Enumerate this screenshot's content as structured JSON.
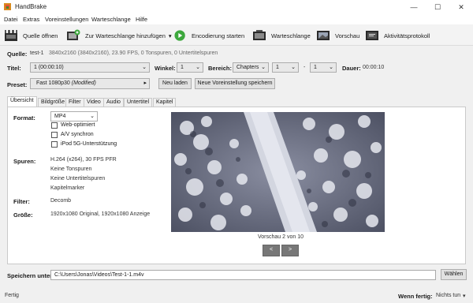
{
  "window": {
    "title": "HandBrake",
    "minimize": "—",
    "maximize": "☐",
    "close": "✕"
  },
  "menu": [
    {
      "label": "Datei"
    },
    {
      "label": "Extras"
    },
    {
      "label": "Voreinstellungen"
    },
    {
      "label": "Warteschlange"
    },
    {
      "label": "Hilfe"
    }
  ],
  "toolbar": {
    "open_source": "Quelle öffnen",
    "add_queue": "Zur Warteschlange hinzufügen",
    "add_queue_arrow": "▾",
    "start_encode": "Encodierung starten",
    "queue": "Warteschlange",
    "preview": "Vorschau",
    "activity_log": "Aktivitätsprotokoll"
  },
  "source": {
    "label": "Quelle:",
    "name": "test-1",
    "details": "3840x2160 (3840x2160), 23.90 FPS, 0 Tonspuren, 0 Untertitelspuren"
  },
  "title_row": {
    "title_label": "Titel:",
    "title_value": "1  (00:00:10)",
    "angle_label": "Winkel:",
    "angle_value": "1",
    "range_label": "Bereich:",
    "range_type": "Chapters",
    "range_start": "1",
    "range_sep": "-",
    "range_end": "1",
    "duration_label": "Dauer:",
    "duration_value": "00:00:10"
  },
  "preset": {
    "label": "Preset:",
    "name": "Fast 1080p30",
    "modified": "(Modified)",
    "arrow": "▸",
    "reload": "Neu laden",
    "save_new": "Neue Voreinstellung speichern"
  },
  "tabs": [
    {
      "label": "Übersicht"
    },
    {
      "label": "Bildgröße"
    },
    {
      "label": "Filter"
    },
    {
      "label": "Video"
    },
    {
      "label": "Audio"
    },
    {
      "label": "Untertitel"
    },
    {
      "label": "Kapitel"
    }
  ],
  "summary": {
    "format_label": "Format:",
    "format_value": "MP4",
    "web_optimized": "Web-optimiert",
    "av_sync": "A/V synchron",
    "ipod": "iPod 5G-Unterstützung",
    "tracks_label": "Spuren:",
    "tracks": [
      "H.264 (x264), 30 FPS PFR",
      "Keine Tonspuren",
      "Keine Untertitelspuren",
      "Kapitelmarker"
    ],
    "filter_label": "Filter:",
    "filter_value": "Decomb",
    "size_label": "Größe:",
    "size_value": "1920x1080 Original, 1920x1080 Anzeige",
    "preview_caption": "Vorschau 2 von 10",
    "prev": "<",
    "next": ">"
  },
  "save": {
    "label": "Speichern unter:",
    "path": "C:\\Users\\Jonas\\Videos\\Test-1-1.m4v",
    "browse": "Wählen"
  },
  "status": {
    "text": "Fertig",
    "when_done_label": "Wenn fertig:",
    "when_done_value": "Nichts tun",
    "when_done_arrow": "▾"
  },
  "colors": {
    "accent": "#0078d7",
    "play_green": "#3da83d",
    "window_bg": "#f0f0f0"
  }
}
